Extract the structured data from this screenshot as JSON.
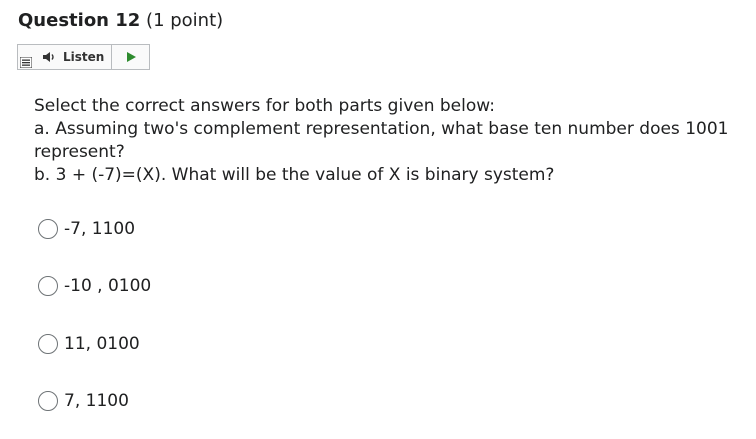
{
  "question": {
    "title": "Question 12",
    "points": "(1 point)"
  },
  "toolbar": {
    "listen_label": "Listen",
    "menu_icon": "menu-icon",
    "speaker_icon": "speaker-icon",
    "play_icon": "play-icon",
    "play_color": "#2e8b2e"
  },
  "prompt": {
    "line1": "Select the correct answers for both parts given below:",
    "line2": "a. Assuming two's complement representation, what base ten number does 1001",
    "line3": "represent?",
    "line4": "b. 3 + (-7)=(X). What will be the value of X is binary system?"
  },
  "choices": [
    {
      "label": "-7, 1100",
      "selected": false
    },
    {
      "label": "-10 , 0100",
      "selected": false
    },
    {
      "label": "11, 0100",
      "selected": false
    },
    {
      "label": "7, 1100",
      "selected": false
    }
  ]
}
